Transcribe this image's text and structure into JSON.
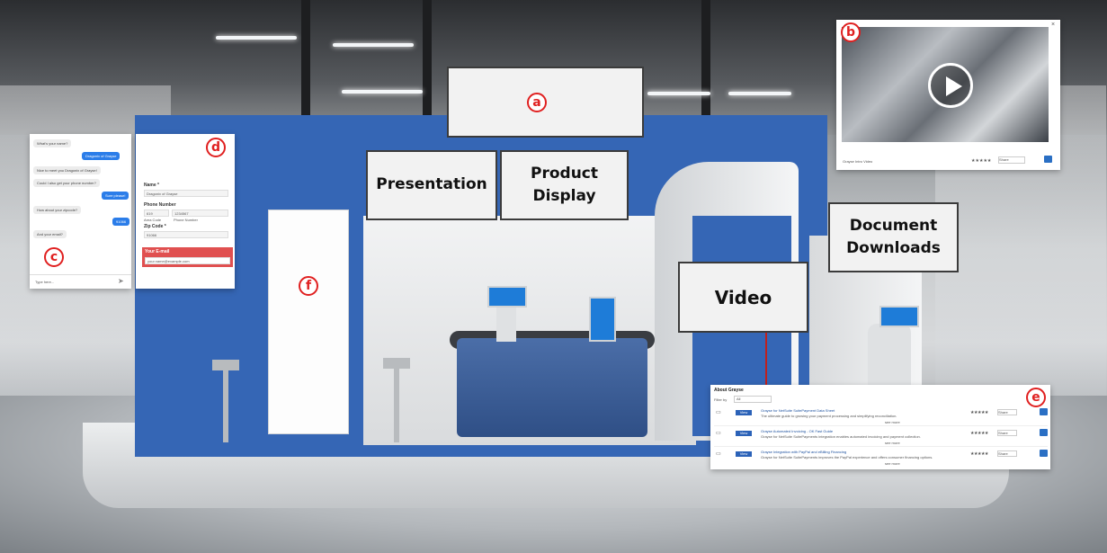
{
  "labels": {
    "presentation": "Presentation",
    "product_display_line1": "Product",
    "product_display_line2": "Display",
    "document_downloads_line1": "Document",
    "document_downloads_line2": "Downloads",
    "video": "Video"
  },
  "badges": {
    "a": "a",
    "b": "b",
    "c": "c",
    "d": "d",
    "e": "e",
    "f": "f"
  },
  "chat": {
    "messages": [
      {
        "text": "What's your name?",
        "from": "bot"
      },
      {
        "text": "Dragonix of Grayse",
        "from": "user"
      },
      {
        "text": "Nice to meet you Dragonix of Grayse!",
        "from": "bot"
      },
      {
        "text": "Could I also get your phone number?",
        "from": "bot"
      },
      {
        "text": "Sure please!",
        "from": "user"
      },
      {
        "text": "How about your zipcode?",
        "from": "bot"
      },
      {
        "text": "91066",
        "from": "user"
      },
      {
        "text": "And your email?",
        "from": "bot"
      }
    ],
    "input_placeholder": "Type here..."
  },
  "form": {
    "name_label": "Name *",
    "name_value": "Dragonix of Grayse",
    "phone_label": "Phone Number",
    "area_code_value": "619",
    "phone_value": "1234567",
    "area_code_label": "Area Code",
    "phone_number_label": "Phone Number",
    "zip_label": "Zip Code *",
    "zip_value": "91066",
    "email_label": "Your E-mail",
    "email_placeholder": "your.name@example.com"
  },
  "video_popup": {
    "caption": "Grayse Intro Video",
    "stars": "★★★★★",
    "select": "Share",
    "close": "×"
  },
  "docs_popup": {
    "title": "About Grayse",
    "filter_label": "Filter by",
    "filter_value": "All",
    "view_label": "View",
    "rows": [
      {
        "title": "Grayse for NetSuite SuitePayment Data Sheet",
        "desc": "The ultimate guide to growing your payment processing and simplifying reconciliation.",
        "more": "see more",
        "stars": "★★★★★",
        "select": "Share"
      },
      {
        "title": "Grayse Automated Invoicing - OK Fast Guide",
        "desc": "Grayse for NetSuite SuitePayments integration enables automated invoicing and payment collection.",
        "more": "see more",
        "stars": "★★★★★",
        "select": "Share"
      },
      {
        "title": "Grayse Integration with PayPal and eBilling Financing",
        "desc": "Grayse for NetSuite SuitePayments improves the PayPal experience and offers consumer financing options.",
        "more": "see more",
        "stars": "★★★★★",
        "select": "Share"
      }
    ]
  },
  "colors": {
    "booth_blue": "#3566b5",
    "badge_red": "#e02020",
    "chat_blue": "#2b7de9",
    "email_red": "#e05050"
  }
}
